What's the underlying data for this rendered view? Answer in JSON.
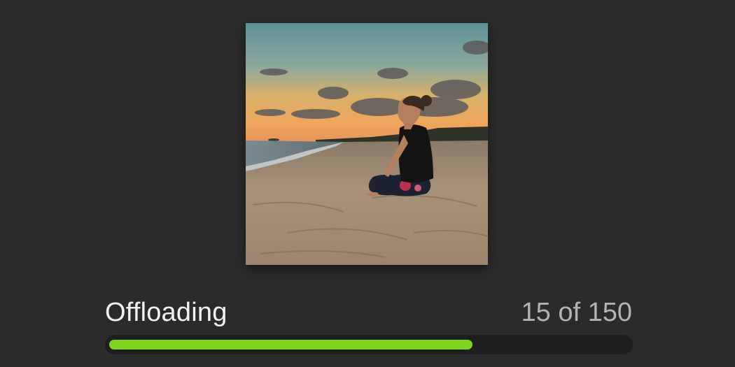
{
  "status": {
    "label": "Offloading",
    "count_text": "15 of 150"
  },
  "progress": {
    "fraction": 0.7
  },
  "colors": {
    "background": "#2b2b2b",
    "track": "#1e1e1e",
    "fill": "#7ed321"
  },
  "photo": {
    "icon": "beach-meditation-photo"
  }
}
